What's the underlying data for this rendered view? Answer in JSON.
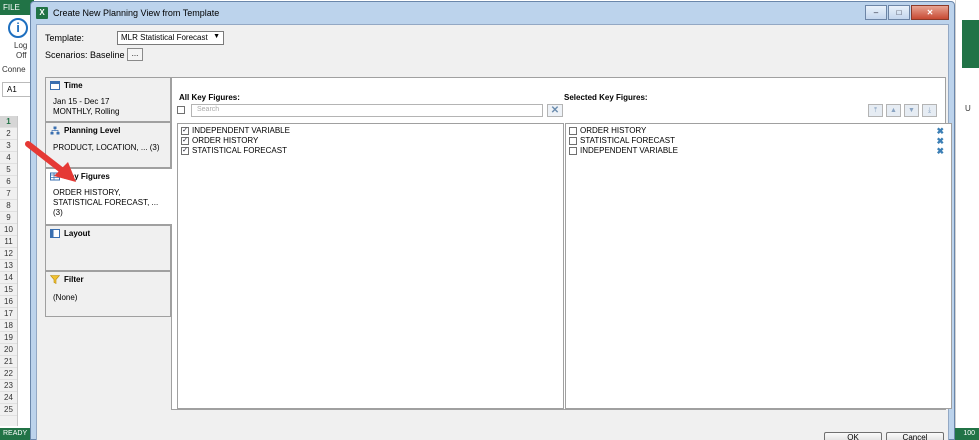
{
  "excel": {
    "file_tab": "FILE",
    "logo_letter": "i",
    "ribbon_text_1": "Log",
    "ribbon_text_2": "Off",
    "connect_text": "Conne",
    "name_box": "A1",
    "row_numbers": [
      "1",
      "2",
      "3",
      "4",
      "5",
      "6",
      "7",
      "8",
      "9",
      "10",
      "11",
      "12",
      "13",
      "14",
      "15",
      "16",
      "17",
      "18",
      "19",
      "20",
      "21",
      "22",
      "23",
      "24",
      "25"
    ],
    "col_letter": "U",
    "status": "READY",
    "zoom": "100"
  },
  "dialog": {
    "title": "Create New Planning View from Template",
    "window_buttons": [
      "–",
      "□",
      "✕"
    ],
    "template_label": "Template:",
    "template_value": "MLR Statistical Forecast",
    "scenarios_label": "Scenarios:",
    "scenarios_value": "Baseline",
    "scenarios_button": "...",
    "nav": [
      {
        "title": "Time",
        "desc": "Jan 15 - Dec 17\nMONTHLY, Rolling",
        "icon": "calendar-icon"
      },
      {
        "title": "Planning Level",
        "desc": "PRODUCT, LOCATION, ... (3)",
        "icon": "hierarchy-icon"
      },
      {
        "title": "Key Figures",
        "desc": "ORDER HISTORY,\nSTATISTICAL FORECAST, ...\n(3)",
        "icon": "key-figures-icon"
      },
      {
        "title": "Layout",
        "desc": "",
        "icon": "layout-icon"
      },
      {
        "title": "Filter",
        "desc": "(None)",
        "icon": "filter-icon"
      }
    ],
    "all_title": "All Key Figures:",
    "search_placeholder": "Search",
    "all_items": [
      "INDEPENDENT VARIABLE",
      "ORDER HISTORY",
      "STATISTICAL FORECAST"
    ],
    "selected_title": "Selected Key Figures:",
    "selected_items": [
      "ORDER HISTORY",
      "STATISTICAL FORECAST",
      "INDEPENDENT VARIABLE"
    ],
    "ok_label": "OK",
    "cancel_label": "Cancel"
  }
}
